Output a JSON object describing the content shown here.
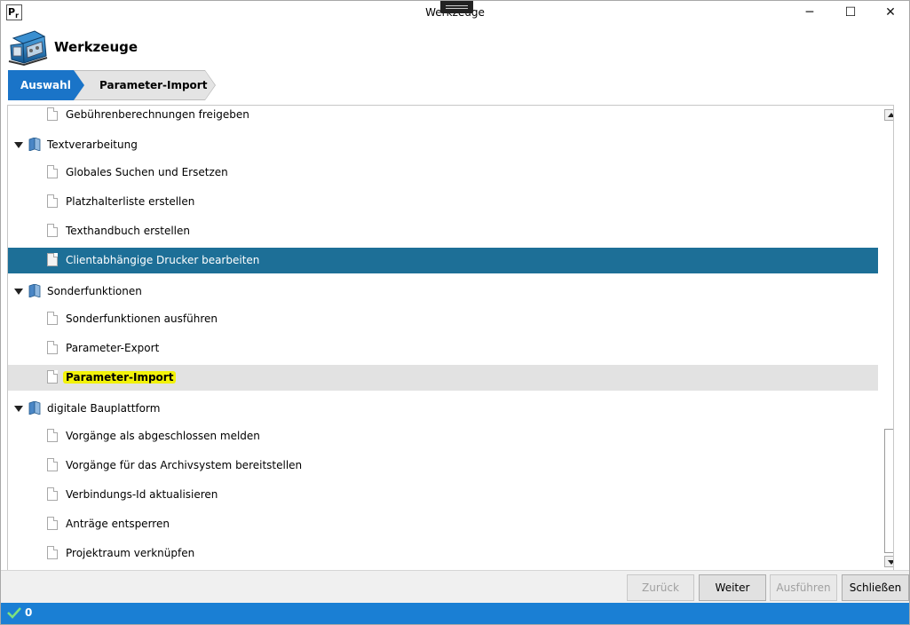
{
  "window": {
    "title": "Werkzeuge",
    "app_icon_text": "P",
    "min_glyph": "─",
    "max_glyph": "☐",
    "close_glyph": "✕"
  },
  "header": {
    "title": "Werkzeuge",
    "icon": "toolbox-icon"
  },
  "breadcrumb": {
    "step1": "Auswahl",
    "step2": "Parameter-Import"
  },
  "tree": {
    "items": [
      {
        "label": "Gebührenberechnungen freigeben"
      },
      {
        "label": "Textverarbeitung"
      },
      {
        "label": "Globales Suchen und Ersetzen"
      },
      {
        "label": "Platzhalterliste erstellen"
      },
      {
        "label": "Texthandbuch erstellen"
      },
      {
        "label": "Clientabhängige Drucker bearbeiten"
      },
      {
        "label": "Sonderfunktionen"
      },
      {
        "label": "Sonderfunktionen ausführen"
      },
      {
        "label": "Parameter-Export"
      },
      {
        "label": "Parameter-Import"
      },
      {
        "label": "digitale Bauplattform"
      },
      {
        "label": "Vorgänge als abgeschlossen melden"
      },
      {
        "label": "Vorgänge für das Archivsystem bereitstellen"
      },
      {
        "label": "Verbindungs-Id aktualisieren"
      },
      {
        "label": "Anträge entsperren"
      },
      {
        "label": "Projektraum verknüpfen"
      }
    ]
  },
  "footer": {
    "back_label": "Zurück",
    "next_label": "Weiter",
    "run_label": "Ausführen",
    "close_label": "Schließen"
  },
  "status": {
    "count": "0"
  },
  "colors": {
    "accent": "#1a74c8",
    "selected_row": "#1d6f97",
    "status_bar": "#1a7fd4",
    "highlight_marker": "#f2f20a"
  }
}
